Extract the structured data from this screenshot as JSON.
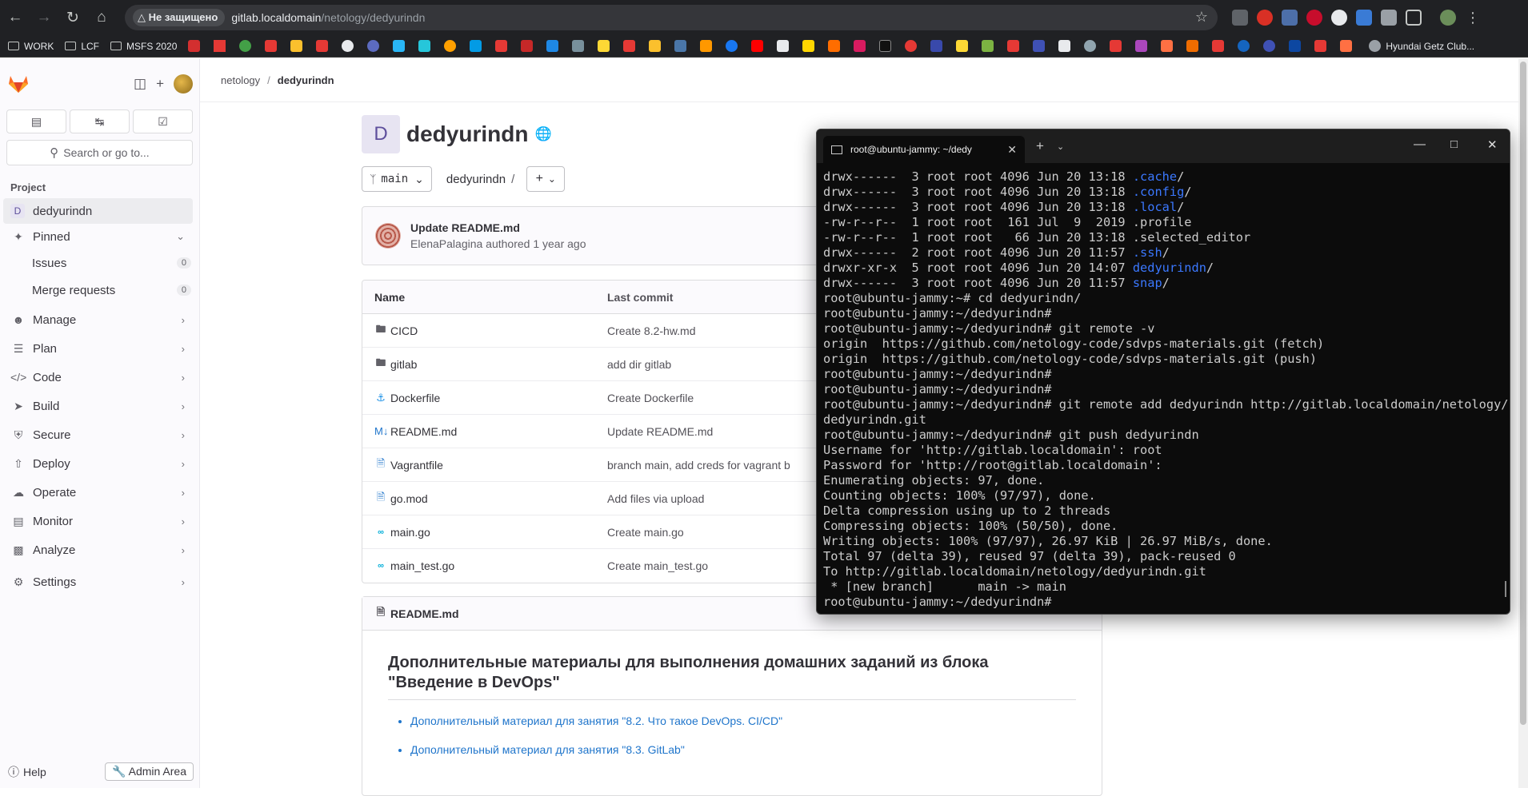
{
  "browser": {
    "insecure_label": "Не защищено",
    "url_host": "gitlab.localdomain",
    "url_path": "/netology/dedyurindn",
    "bookmarks_folders": [
      "WORK",
      "LCF",
      "MSFS 2020"
    ],
    "bookmark_last": "Hyundai Getz Club..."
  },
  "sidebar": {
    "search_placeholder": "Search or go to...",
    "section_title": "Project",
    "project_item": "dedyurindn",
    "project_letter": "D",
    "pinned_label": "Pinned",
    "pinned_items": [
      {
        "label": "Issues",
        "count": "0"
      },
      {
        "label": "Merge requests",
        "count": "0"
      }
    ],
    "nav_items": [
      "Manage",
      "Plan",
      "Code",
      "Build",
      "Secure",
      "Deploy",
      "Operate",
      "Monitor",
      "Analyze",
      "Settings"
    ],
    "help_label": "Help",
    "admin_label": "Admin Area"
  },
  "breadcrumb": {
    "group": "netology",
    "project": "dedyurindn"
  },
  "project": {
    "letter": "D",
    "title": "dedyurindn",
    "branch": "main",
    "path_root": "dedyurindn",
    "path_sep": "/"
  },
  "last_commit": {
    "title": "Update README.md",
    "meta": "ElenaPalagina authored 1 year ago"
  },
  "file_table": {
    "col_name": "Name",
    "col_commit": "Last commit",
    "rows": [
      {
        "name": "CICD",
        "commit": "Create 8.2-hw.md",
        "icon": "folder"
      },
      {
        "name": "gitlab",
        "commit": "add dir gitlab",
        "icon": "folder"
      },
      {
        "name": "Dockerfile",
        "commit": "Create Dockerfile",
        "icon": "docker"
      },
      {
        "name": "README.md",
        "commit": "Update README.md",
        "icon": "markdown"
      },
      {
        "name": "Vagrantfile",
        "commit": "branch main, add creds for vagrant b",
        "icon": "file"
      },
      {
        "name": "go.mod",
        "commit": "Add files via upload",
        "icon": "file"
      },
      {
        "name": "main.go",
        "commit": "Create main.go",
        "icon": "go"
      },
      {
        "name": "main_test.go",
        "commit": "Create main_test.go",
        "icon": "go"
      }
    ]
  },
  "readme": {
    "filename": "README.md",
    "heading": "Дополнительные материалы для выполнения домашних заданий из блока \"Введение в DevOps\"",
    "links": [
      "Дополнительный материал для занятия \"8.2. Что такое DevOps. CI/CD\"",
      "Дополнительный материал для занятия \"8.3. GitLab\""
    ]
  },
  "terminal": {
    "tab_title": "root@ubuntu-jammy: ~/dedy",
    "lines": [
      {
        "text": "drwx------  3 root root 4096 Jun 20 13:18 ",
        "blue": ".cache",
        "tail": "/"
      },
      {
        "text": "drwx------  3 root root 4096 Jun 20 13:18 ",
        "blue": ".config",
        "tail": "/"
      },
      {
        "text": "drwx------  3 root root 4096 Jun 20 13:18 ",
        "blue": ".local",
        "tail": "/"
      },
      {
        "text": "-rw-r--r--  1 root root  161 Jul  9  2019 .profile",
        "blue": "",
        "tail": ""
      },
      {
        "text": "-rw-r--r--  1 root root   66 Jun 20 13:18 .selected_editor",
        "blue": "",
        "tail": ""
      },
      {
        "text": "drwx------  2 root root 4096 Jun 20 11:57 ",
        "blue": ".ssh",
        "tail": "/"
      },
      {
        "text": "drwxr-xr-x  5 root root 4096 Jun 20 14:07 ",
        "blue": "dedyurindn",
        "tail": "/"
      },
      {
        "text": "drwx------  3 root root 4096 Jun 20 11:57 ",
        "blue": "snap",
        "tail": "/"
      },
      {
        "text": "root@ubuntu-jammy:~# cd dedyurindn/",
        "blue": "",
        "tail": ""
      },
      {
        "text": "root@ubuntu-jammy:~/dedyurindn#",
        "blue": "",
        "tail": ""
      },
      {
        "text": "root@ubuntu-jammy:~/dedyurindn# git remote -v",
        "blue": "",
        "tail": ""
      },
      {
        "text": "origin  https://github.com/netology-code/sdvps-materials.git (fetch)",
        "blue": "",
        "tail": ""
      },
      {
        "text": "origin  https://github.com/netology-code/sdvps-materials.git (push)",
        "blue": "",
        "tail": ""
      },
      {
        "text": "root@ubuntu-jammy:~/dedyurindn#",
        "blue": "",
        "tail": ""
      },
      {
        "text": "root@ubuntu-jammy:~/dedyurindn#",
        "blue": "",
        "tail": ""
      },
      {
        "text": "root@ubuntu-jammy:~/dedyurindn# git remote add dedyurindn http://gitlab.localdomain/netology/",
        "blue": "",
        "tail": ""
      },
      {
        "text": "dedyurindn.git",
        "blue": "",
        "tail": ""
      },
      {
        "text": "root@ubuntu-jammy:~/dedyurindn# git push dedyurindn",
        "blue": "",
        "tail": ""
      },
      {
        "text": "Username for 'http://gitlab.localdomain': root",
        "blue": "",
        "tail": ""
      },
      {
        "text": "Password for 'http://root@gitlab.localdomain':",
        "blue": "",
        "tail": ""
      },
      {
        "text": "Enumerating objects: 97, done.",
        "blue": "",
        "tail": ""
      },
      {
        "text": "Counting objects: 100% (97/97), done.",
        "blue": "",
        "tail": ""
      },
      {
        "text": "Delta compression using up to 2 threads",
        "blue": "",
        "tail": ""
      },
      {
        "text": "Compressing objects: 100% (50/50), done.",
        "blue": "",
        "tail": ""
      },
      {
        "text": "Writing objects: 100% (97/97), 26.97 KiB | 26.97 MiB/s, done.",
        "blue": "",
        "tail": ""
      },
      {
        "text": "Total 97 (delta 39), reused 97 (delta 39), pack-reused 0",
        "blue": "",
        "tail": ""
      },
      {
        "text": "To http://gitlab.localdomain/netology/dedyurindn.git",
        "blue": "",
        "tail": ""
      },
      {
        "text": " * [new branch]      main -> main",
        "blue": "",
        "tail": ""
      },
      {
        "text": "root@ubuntu-jammy:~/dedyurindn#",
        "blue": "",
        "tail": ""
      }
    ]
  }
}
